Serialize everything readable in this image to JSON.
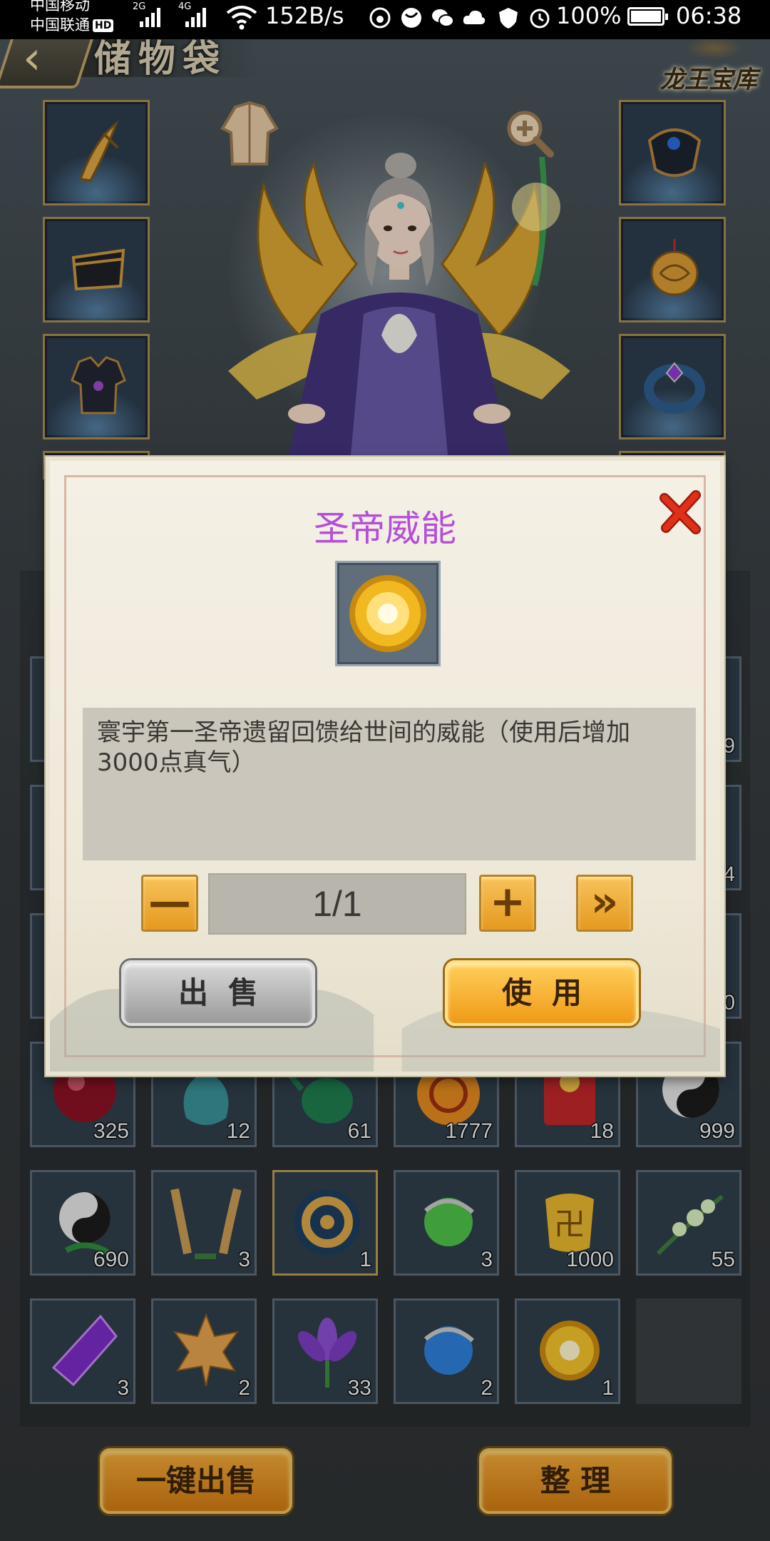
{
  "status_bar": {
    "carrier1": "中国移动",
    "carrier2": "中国联通",
    "carrier2_badge": "HD",
    "net1": "2G",
    "net2": "4G",
    "net_speed": "152B/s",
    "battery": "100%",
    "time": "06:38"
  },
  "header": {
    "title": "储物袋",
    "corner_logo": "龙王宝库"
  },
  "equipment": {
    "left_slots": [
      "weapon",
      "hat",
      "armor"
    ],
    "right_slots": [
      "bracer",
      "pendant",
      "ring"
    ]
  },
  "inventory": {
    "rows": [
      [
        {
          "icon": "red-pill-icon",
          "count": "325"
        },
        {
          "icon": "teal-vase-icon",
          "count": "12"
        },
        {
          "icon": "green-teapot-icon",
          "count": "61"
        },
        {
          "icon": "orange-orb-icon",
          "count": "1777"
        },
        {
          "icon": "red-envelope-icon",
          "count": "18"
        },
        {
          "icon": "yin-yang-icon",
          "count": "999"
        }
      ],
      [
        {
          "icon": "yin-yang-icon",
          "count": "690"
        },
        {
          "icon": "lavender-herb-icon",
          "count": "3"
        },
        {
          "icon": "dragon-jade-icon",
          "count": "1"
        },
        {
          "icon": "green-orb-icon",
          "count": "3"
        },
        {
          "icon": "gold-token-icon",
          "count": "1000"
        },
        {
          "icon": "white-flower-branch-icon",
          "count": "55"
        }
      ],
      [
        {
          "icon": "purple-crystal-icon",
          "count": "3"
        },
        {
          "icon": "maple-leaf-icon",
          "count": "2"
        },
        {
          "icon": "lotus-flower-icon",
          "count": "33"
        },
        {
          "icon": "blue-orb-icon",
          "count": "2"
        },
        {
          "icon": "sun-orb-icon",
          "count": "1"
        },
        {
          "icon": "",
          "count": ""
        }
      ]
    ],
    "partial_right_counts": [
      "9",
      "4",
      "0"
    ]
  },
  "bottom": {
    "sell_all_label": "一键出售",
    "organize_label": "整 理"
  },
  "dialog": {
    "title": "圣帝威能",
    "description": "寰宇第一圣帝遗留回馈给世间的威能（使用后增加3000点真气）",
    "quantity": "1/1",
    "minus_label": "—",
    "plus_label": "+",
    "max_label": "»",
    "sell_label": "出售",
    "use_label": "使用",
    "colors": {
      "title": "#b44fd8",
      "close": "#e0301a",
      "gold_button": "#f0a838"
    }
  }
}
